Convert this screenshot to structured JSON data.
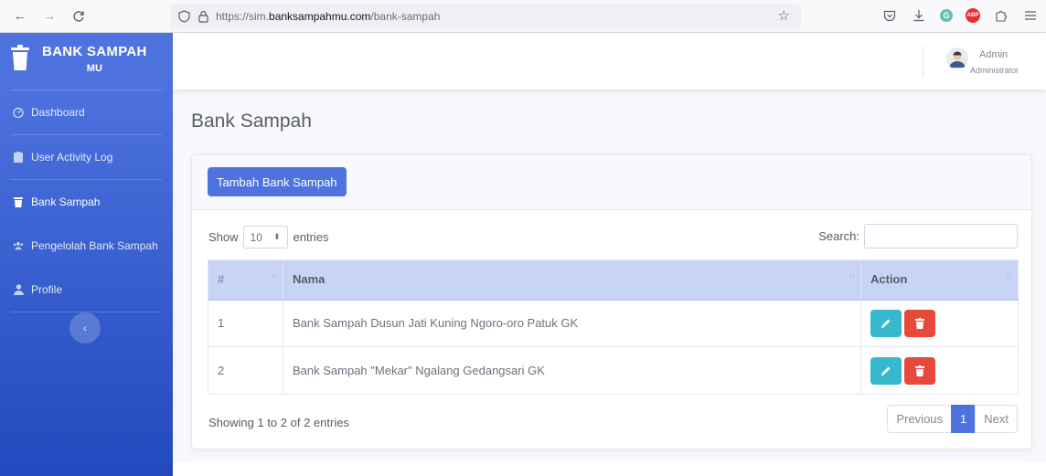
{
  "browser": {
    "url_prefix": "https://sim.",
    "url_host": "banksampahmu.com",
    "url_path": "/bank-sampah",
    "abp_label": "ABP",
    "g_label": "G"
  },
  "sidebar": {
    "brand_line1": "BANK SAMPAH",
    "brand_line2": "MU",
    "items": [
      {
        "label": "Dashboard",
        "icon": "dashboard-icon"
      },
      {
        "label": "User Activity Log",
        "icon": "clipboard-icon"
      },
      {
        "label": "Bank Sampah",
        "icon": "trash-icon"
      },
      {
        "label": "Pengelolah Bank Sampah",
        "icon": "users-icon"
      },
      {
        "label": "Profile",
        "icon": "user-icon"
      }
    ],
    "toggle_glyph": "‹"
  },
  "topbar": {
    "user_name": "Admin",
    "user_role": "Administrator"
  },
  "page": {
    "title": "Bank Sampah",
    "add_button": "Tambah Bank Sampah",
    "show_label": "Show",
    "entries_value": "10",
    "entries_label": "entries",
    "search_label": "Search:"
  },
  "table": {
    "columns": [
      "#",
      "Nama",
      "Action"
    ],
    "rows": [
      {
        "num": "1",
        "nama": "Bank Sampah Dusun Jati Kuning Ngoro-oro Patuk GK"
      },
      {
        "num": "2",
        "nama": "Bank Sampah \"Mekar\" Ngalang Gedangsari GK"
      }
    ]
  },
  "footer": {
    "info": "Showing 1 to 2 of 2 entries",
    "prev": "Previous",
    "page": "1",
    "next": "Next"
  },
  "colors": {
    "primary": "#4e73df",
    "info": "#36b9cc",
    "danger": "#e74a3b"
  }
}
